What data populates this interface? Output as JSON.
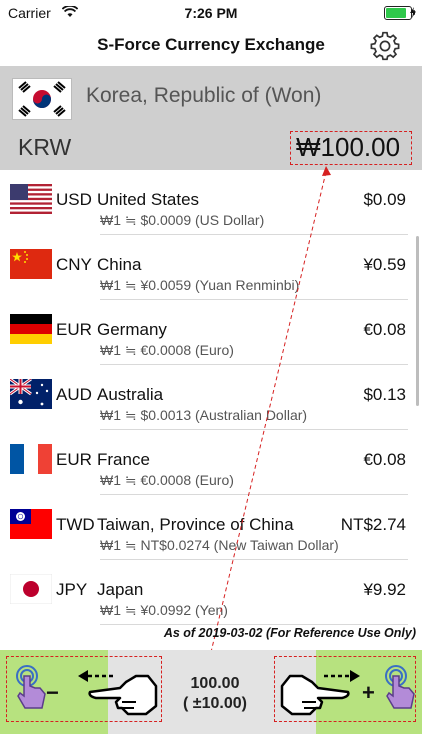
{
  "status_bar": {
    "carrier": "Carrier",
    "time": "7:26 PM"
  },
  "header": {
    "title": "S-Force Currency Exchange",
    "settings_icon": "gear-icon"
  },
  "base": {
    "country": "Korea, Republic of (Won)",
    "code": "KRW",
    "amount": "₩100.00",
    "flag_icon": "korea-flag-icon"
  },
  "rows": [
    {
      "code": "USD",
      "country": "United States",
      "rate": "₩1 ≒ $0.0009 (US Dollar)",
      "amount": "$0.09",
      "flag_icon": "usa-flag-icon"
    },
    {
      "code": "CNY",
      "country": "China",
      "rate": "₩1 ≒ ¥0.0059 (Yuan Renminbi)",
      "amount": "¥0.59",
      "flag_icon": "china-flag-icon"
    },
    {
      "code": "EUR",
      "country": "Germany",
      "rate": "₩1 ≒ €0.0008 (Euro)",
      "amount": "€0.08",
      "flag_icon": "germany-flag-icon"
    },
    {
      "code": "AUD",
      "country": "Australia",
      "rate": "₩1 ≒ $0.0013 (Australian Dollar)",
      "amount": "$0.13",
      "flag_icon": "australia-flag-icon"
    },
    {
      "code": "EUR",
      "country": "France",
      "rate": "₩1 ≒ €0.0008 (Euro)",
      "amount": "€0.08",
      "flag_icon": "france-flag-icon"
    },
    {
      "code": "TWD",
      "country": "Taiwan, Province of China",
      "rate": "₩1 ≒ NT$0.0274 (New Taiwan Dollar)",
      "amount": "NT$2.74",
      "flag_icon": "taiwan-flag-icon"
    },
    {
      "code": "JPY",
      "country": "Japan",
      "rate": "₩1 ≒ ¥0.0992 (Yen)",
      "amount": "¥9.92",
      "flag_icon": "japan-flag-icon"
    }
  ],
  "footer_note": "As of 2019-03-02 (For Reference Use Only)",
  "stepper": {
    "value": "100.00",
    "step": "( ±10.00)",
    "minus_label": "−",
    "plus_label": "+",
    "decrease_icon": "tap-finger-icon",
    "increase_icon": "tap-finger-icon"
  },
  "colors": {
    "accent_green": "#b7e27f",
    "annotation_red": "#d62020",
    "header_gray": "#cfcfcf"
  }
}
